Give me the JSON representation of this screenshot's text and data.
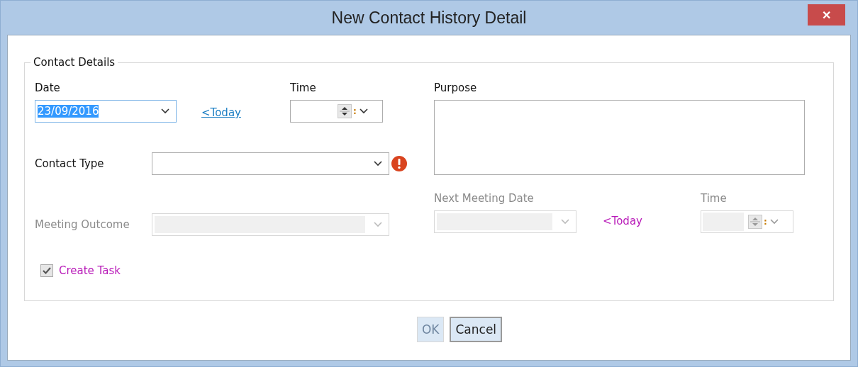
{
  "window": {
    "title": "New Contact History Detail",
    "close": "✕"
  },
  "group": {
    "title": "Contact Details"
  },
  "date": {
    "label": "Date",
    "value": "23/09/2016",
    "focused": true,
    "disabled": false
  },
  "today_link": {
    "label": "<Today",
    "disabled": false
  },
  "time": {
    "label": "Time",
    "separator": ":",
    "disabled": false
  },
  "purpose": {
    "label": "Purpose"
  },
  "contact_type": {
    "label": "Contact Type",
    "disabled": false,
    "error": true
  },
  "meeting_outcome": {
    "label": "Meeting Outcome",
    "disabled": true
  },
  "next_meeting_date": {
    "label": "Next Meeting Date",
    "disabled": true
  },
  "next_today_link": {
    "label": "<Today",
    "disabled": true
  },
  "next_time": {
    "label": "Time",
    "separator": ":",
    "disabled": true
  },
  "create_task": {
    "label": "Create Task",
    "checked": true,
    "disabled": true
  },
  "buttons": [
    {
      "label": "OK",
      "disabled": true,
      "focused": false
    },
    {
      "label": "Cancel",
      "disabled": false,
      "focused": true
    }
  ]
}
